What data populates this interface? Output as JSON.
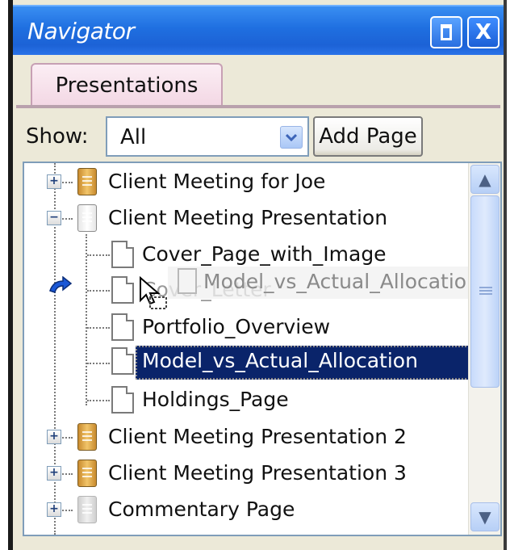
{
  "window": {
    "title": "Navigator",
    "restore_icon": "restore-icon",
    "close_icon": "close-icon",
    "close_glyph": "X"
  },
  "tabs": [
    {
      "label": "Presentations"
    }
  ],
  "filter": {
    "label": "Show:",
    "value": "All",
    "dropdown_glyph": "⌄",
    "add_page_label": "Add Page"
  },
  "tree": {
    "items": [
      {
        "label": "Client Meeting for Joe",
        "type": "presentation",
        "expander": "+"
      },
      {
        "label": "Client Meeting Presentation",
        "type": "presentation-open",
        "expander": "−"
      },
      {
        "label": "Cover_Page_with_Image",
        "type": "page"
      },
      {
        "label": "Cover_Letter",
        "type": "page"
      },
      {
        "label": "Portfolio_Overview",
        "type": "page"
      },
      {
        "label": "Model_vs_Actual_Allocation",
        "type": "page",
        "selected": true
      },
      {
        "label": "Holdings_Page",
        "type": "page"
      },
      {
        "label": "Client Meeting Presentation 2",
        "type": "presentation",
        "expander": "+"
      },
      {
        "label": "Client Meeting Presentation 3",
        "type": "presentation",
        "expander": "+"
      },
      {
        "label": "Commentary Page",
        "type": "page-group",
        "expander": "+"
      }
    ],
    "drag_ghost_label": "Model_vs_Actual_Allocation"
  },
  "scrollbar": {
    "up_glyph": "▲",
    "down_glyph": "▼"
  },
  "colors": {
    "titlebar": "#1f6fe0",
    "selection": "#0a246a",
    "tab": "#f3d7e4"
  }
}
